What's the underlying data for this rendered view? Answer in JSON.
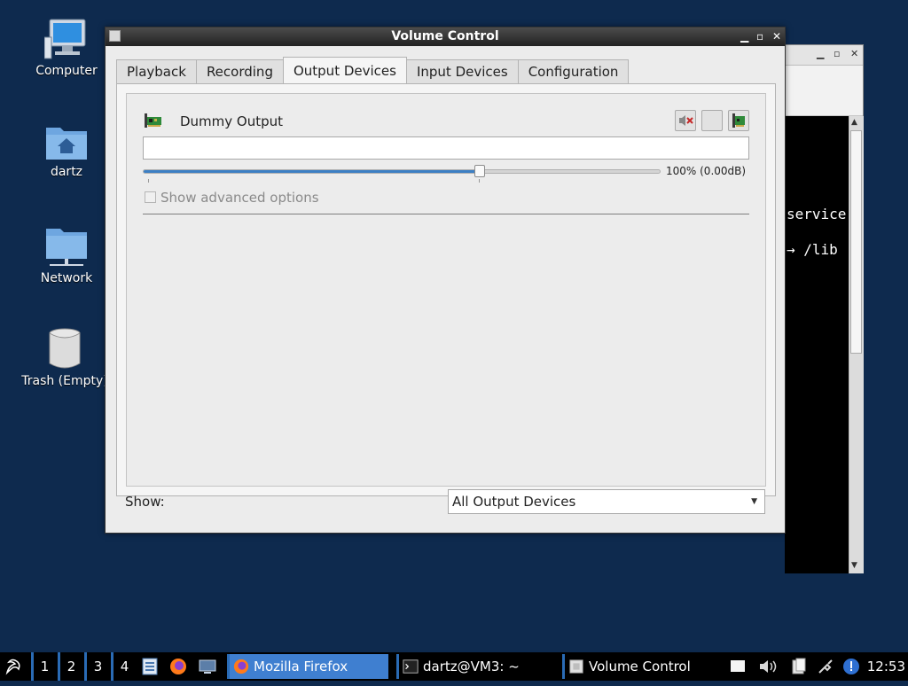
{
  "desktop": {
    "icons": [
      {
        "label": "Computer"
      },
      {
        "label": "dartz"
      },
      {
        "label": "Network"
      },
      {
        "label": "Trash (Empty)"
      }
    ]
  },
  "terminal_bg": {
    "lines": [
      "service",
      "→ /lib"
    ]
  },
  "window": {
    "title": "Volume Control",
    "tabs": [
      {
        "label": "Playback",
        "active": false
      },
      {
        "label": "Recording",
        "active": false
      },
      {
        "label": "Output Devices",
        "active": true
      },
      {
        "label": "Input Devices",
        "active": false
      },
      {
        "label": "Configuration",
        "active": false
      }
    ],
    "device": {
      "name": "Dummy Output",
      "port_value": "",
      "volume_percent": 65,
      "volume_label": "100% (0.00dB)",
      "advanced_label": "Show advanced options",
      "advanced_checked": false
    },
    "show_label": "Show:",
    "show_select": {
      "value": "All Output Devices"
    }
  },
  "taskbar": {
    "workspaces": [
      "1",
      "2",
      "3",
      "4"
    ],
    "tasks": [
      {
        "label": "Mozilla Firefox",
        "active": true
      },
      {
        "label": "dartz@VM3: ~",
        "active": false
      },
      {
        "label": "Volume Control",
        "active": false
      }
    ],
    "clock": "12:53"
  },
  "colors": {
    "desktop_bg": "#0e2a4e",
    "accent": "#3c7fc4",
    "taskbar_active": "#3f7fd0"
  }
}
